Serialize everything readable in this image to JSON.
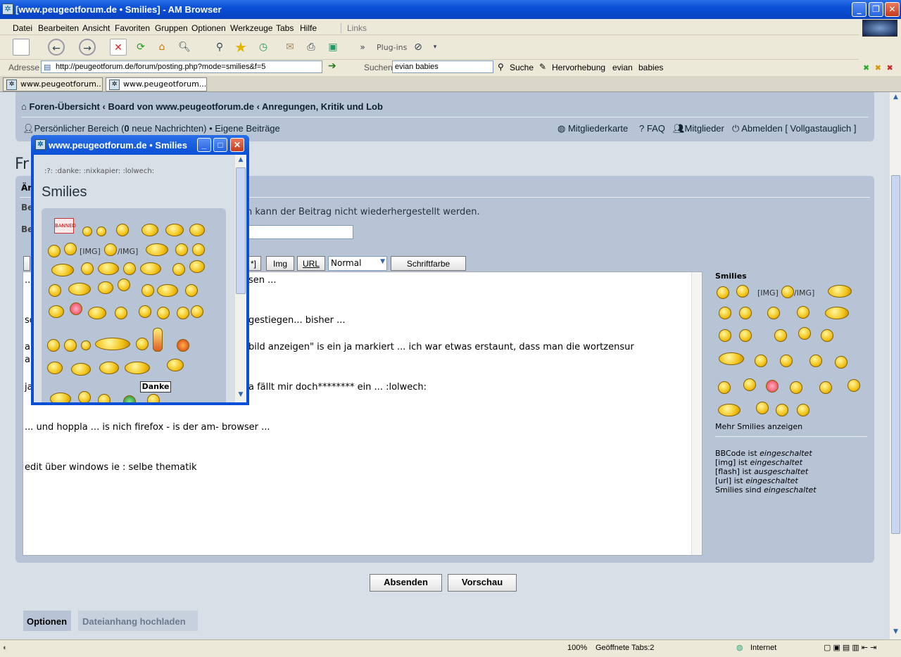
{
  "window": {
    "title": "[www.peugeotforum.de • Smilies] - AM Browser"
  },
  "menu": [
    "Datei",
    "Bearbeiten",
    "Ansicht",
    "Favoriten",
    "Gruppen",
    "Optionen",
    "Werkzeuge",
    "Tabs",
    "Hilfe"
  ],
  "menu_links": "Links",
  "toolbar": {
    "plugins": "Plug-ins"
  },
  "address": {
    "label": "Adresse",
    "url": "http://peugeotforum.de/forum/posting.php?mode=smilies&f=5",
    "search_label": "Suchen",
    "search_value": "evian babies",
    "suche": "Suche",
    "hervorhebung": "Hervorhebung",
    "word1": "evian",
    "word2": "babies"
  },
  "tabs": [
    "www.peugeotforum....",
    "www.peugeotforum...."
  ],
  "forum": {
    "breadcrumb": "Foren-Übersicht ‹ Board von www.peugeotforum.de ‹ Anregungen, Kritik und Lob",
    "personal": "Persönlicher Bereich (",
    "personal_count": "0",
    "personal_rest": " neue Nachrichten) • Eigene Beiträge",
    "nav_right": [
      "Mitgliederkarte",
      "FAQ",
      "Mitglieder",
      "Abmelden [ Vollgastauglich ]"
    ],
    "page_title_partial": "Fr",
    "section_partial": "Än",
    "row1_partial": "Be",
    "row2_partial": "Be",
    "warning_text": "n kann der Beitrag nicht wiederhergestellt werden.",
    "subject_value": "e",
    "bb_buttons": {
      "quote_end": "*]",
      "img": "Img",
      "url": "URL",
      "size": "Normal",
      "color": "Schriftfarbe"
    },
    "editor_lines": [
      {
        "left": "..",
        "right": "sen ..."
      },
      {
        "left": "so",
        "right": "gestiegen... bisher ..."
      },
      {
        "left": "al",
        "right": "bild anzeigen\" is ein ja markiert ...  ich war etwas erstaunt, dass man die wortzensur"
      },
      {
        "left": "au",
        "right": ""
      },
      {
        "left": "ja",
        "right": "a fällt mir doch******** ein ... :lolwech:"
      },
      {
        "left": "... und hoppla ... is nich firefox - is der am- browser ...",
        "right": ""
      },
      {
        "left": "edit über windows ie :  selbe thematik",
        "right": ""
      }
    ],
    "smilies_title": "Smilies",
    "img_text": "[IMG]",
    "img_end": "/IMG]",
    "more_smilies": "Mehr Smilies anzeigen",
    "bbcode": [
      {
        "label": "BBCode ist ",
        "state": "eingeschaltet"
      },
      {
        "label": "[img] ist ",
        "state": "eingeschaltet"
      },
      {
        "label": "[flash] ist ",
        "state": "ausgeschaltet"
      },
      {
        "label": "[url] ist ",
        "state": "eingeschaltet"
      },
      {
        "label": "Smilies sind ",
        "state": "eingeschaltet"
      }
    ],
    "submit": "Absenden",
    "preview": "Vorschau",
    "bottom_tabs": [
      "Optionen",
      "Dateianhang hochladen"
    ]
  },
  "popup": {
    "title": "www.peugeotforum.de • Smilies",
    "codes": ":?:  :danke:  :nixkapier:  :lolwech:",
    "heading": "Smilies",
    "img_text": "[IMG]",
    "img_end": "/IMG]",
    "banned": "BANNED",
    "danke_sign": "Danke"
  },
  "status": {
    "zoom": "100%",
    "tabs": "Geöffnete Tabs:2",
    "zone": "Internet"
  }
}
